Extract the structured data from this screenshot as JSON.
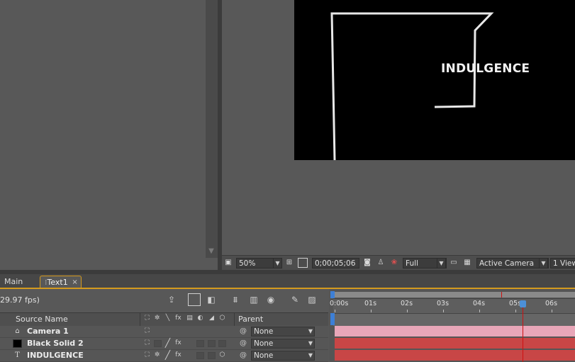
{
  "viewer": {
    "comp_text": "INDULGENCE",
    "zoom": "50%",
    "timecode": "0;00;05;06",
    "resolution": "Full",
    "camera": "Active Camera",
    "views": "1 View"
  },
  "tabs": [
    {
      "label": "Main"
    },
    {
      "label": "Text1"
    }
  ],
  "timeline": {
    "fps": "29.97 fps)",
    "headers": {
      "source_name": "Source Name",
      "parent": "Parent"
    },
    "layers": [
      {
        "name": "Camera 1",
        "type": "camera",
        "parent": "None"
      },
      {
        "name": "Black Solid 2",
        "type": "solid",
        "parent": "None"
      },
      {
        "name": "INDULGENCE",
        "type": "text",
        "parent": "None"
      }
    ],
    "ruler_labels": [
      "0:00s",
      "01s",
      "02s",
      "03s",
      "04s",
      "05s",
      "06s"
    ],
    "current_time_seconds": 5.2
  },
  "colors": {
    "accent_tab": "#d49a1e",
    "cti": "#d01010",
    "camera_bar": "#e8a6b8",
    "layer_bar": "#c84646"
  }
}
